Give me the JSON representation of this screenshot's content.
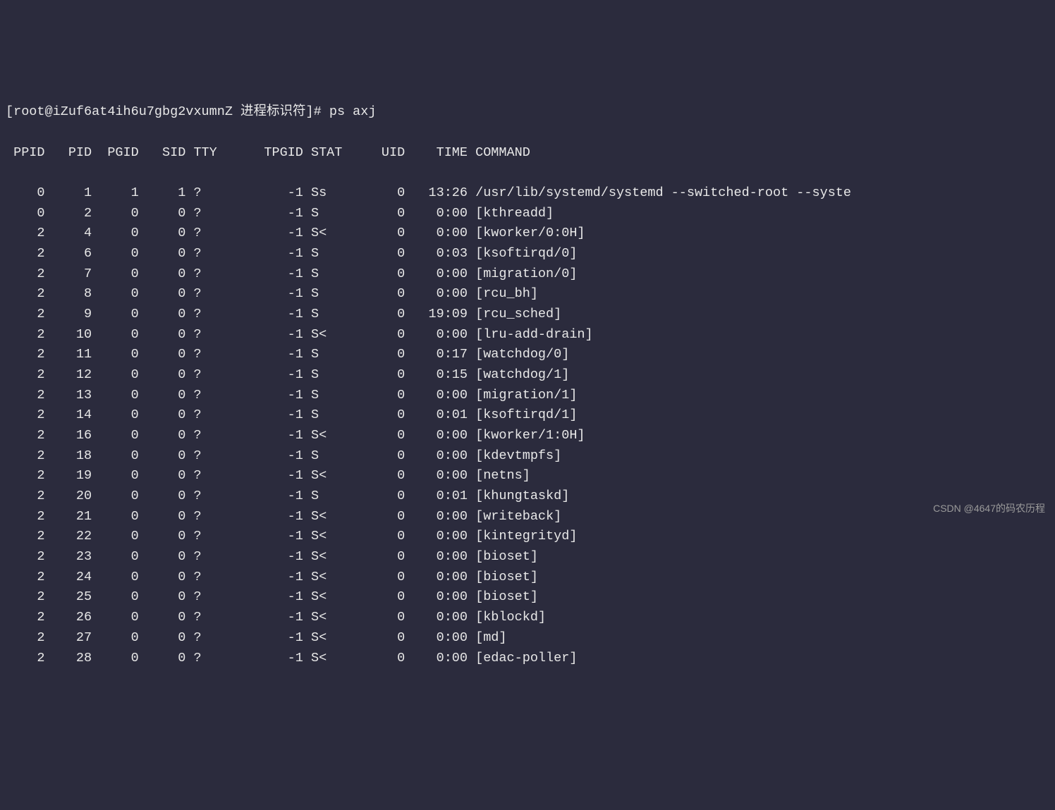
{
  "prompt": {
    "user_host": "[root@iZuf6at4ih6u7gbg2vxumnZ 进程标识符]# ",
    "command": "ps axj"
  },
  "headers": [
    "PPID",
    "PID",
    "PGID",
    "SID",
    "TTY",
    "TPGID",
    "STAT",
    "UID",
    "TIME",
    "COMMAND"
  ],
  "rows": [
    {
      "ppid": "0",
      "pid": "1",
      "pgid": "1",
      "sid": "1",
      "tty": "?",
      "tpgid": "-1",
      "stat": "Ss",
      "uid": "0",
      "time": "13:26",
      "command": "/usr/lib/systemd/systemd --switched-root --syste"
    },
    {
      "ppid": "0",
      "pid": "2",
      "pgid": "0",
      "sid": "0",
      "tty": "?",
      "tpgid": "-1",
      "stat": "S",
      "uid": "0",
      "time": "0:00",
      "command": "[kthreadd]"
    },
    {
      "ppid": "2",
      "pid": "4",
      "pgid": "0",
      "sid": "0",
      "tty": "?",
      "tpgid": "-1",
      "stat": "S<",
      "uid": "0",
      "time": "0:00",
      "command": "[kworker/0:0H]"
    },
    {
      "ppid": "2",
      "pid": "6",
      "pgid": "0",
      "sid": "0",
      "tty": "?",
      "tpgid": "-1",
      "stat": "S",
      "uid": "0",
      "time": "0:03",
      "command": "[ksoftirqd/0]"
    },
    {
      "ppid": "2",
      "pid": "7",
      "pgid": "0",
      "sid": "0",
      "tty": "?",
      "tpgid": "-1",
      "stat": "S",
      "uid": "0",
      "time": "0:00",
      "command": "[migration/0]"
    },
    {
      "ppid": "2",
      "pid": "8",
      "pgid": "0",
      "sid": "0",
      "tty": "?",
      "tpgid": "-1",
      "stat": "S",
      "uid": "0",
      "time": "0:00",
      "command": "[rcu_bh]"
    },
    {
      "ppid": "2",
      "pid": "9",
      "pgid": "0",
      "sid": "0",
      "tty": "?",
      "tpgid": "-1",
      "stat": "S",
      "uid": "0",
      "time": "19:09",
      "command": "[rcu_sched]"
    },
    {
      "ppid": "2",
      "pid": "10",
      "pgid": "0",
      "sid": "0",
      "tty": "?",
      "tpgid": "-1",
      "stat": "S<",
      "uid": "0",
      "time": "0:00",
      "command": "[lru-add-drain]"
    },
    {
      "ppid": "2",
      "pid": "11",
      "pgid": "0",
      "sid": "0",
      "tty": "?",
      "tpgid": "-1",
      "stat": "S",
      "uid": "0",
      "time": "0:17",
      "command": "[watchdog/0]"
    },
    {
      "ppid": "2",
      "pid": "12",
      "pgid": "0",
      "sid": "0",
      "tty": "?",
      "tpgid": "-1",
      "stat": "S",
      "uid": "0",
      "time": "0:15",
      "command": "[watchdog/1]"
    },
    {
      "ppid": "2",
      "pid": "13",
      "pgid": "0",
      "sid": "0",
      "tty": "?",
      "tpgid": "-1",
      "stat": "S",
      "uid": "0",
      "time": "0:00",
      "command": "[migration/1]"
    },
    {
      "ppid": "2",
      "pid": "14",
      "pgid": "0",
      "sid": "0",
      "tty": "?",
      "tpgid": "-1",
      "stat": "S",
      "uid": "0",
      "time": "0:01",
      "command": "[ksoftirqd/1]"
    },
    {
      "ppid": "2",
      "pid": "16",
      "pgid": "0",
      "sid": "0",
      "tty": "?",
      "tpgid": "-1",
      "stat": "S<",
      "uid": "0",
      "time": "0:00",
      "command": "[kworker/1:0H]"
    },
    {
      "ppid": "2",
      "pid": "18",
      "pgid": "0",
      "sid": "0",
      "tty": "?",
      "tpgid": "-1",
      "stat": "S",
      "uid": "0",
      "time": "0:00",
      "command": "[kdevtmpfs]"
    },
    {
      "ppid": "2",
      "pid": "19",
      "pgid": "0",
      "sid": "0",
      "tty": "?",
      "tpgid": "-1",
      "stat": "S<",
      "uid": "0",
      "time": "0:00",
      "command": "[netns]"
    },
    {
      "ppid": "2",
      "pid": "20",
      "pgid": "0",
      "sid": "0",
      "tty": "?",
      "tpgid": "-1",
      "stat": "S",
      "uid": "0",
      "time": "0:01",
      "command": "[khungtaskd]"
    },
    {
      "ppid": "2",
      "pid": "21",
      "pgid": "0",
      "sid": "0",
      "tty": "?",
      "tpgid": "-1",
      "stat": "S<",
      "uid": "0",
      "time": "0:00",
      "command": "[writeback]"
    },
    {
      "ppid": "2",
      "pid": "22",
      "pgid": "0",
      "sid": "0",
      "tty": "?",
      "tpgid": "-1",
      "stat": "S<",
      "uid": "0",
      "time": "0:00",
      "command": "[kintegrityd]"
    },
    {
      "ppid": "2",
      "pid": "23",
      "pgid": "0",
      "sid": "0",
      "tty": "?",
      "tpgid": "-1",
      "stat": "S<",
      "uid": "0",
      "time": "0:00",
      "command": "[bioset]"
    },
    {
      "ppid": "2",
      "pid": "24",
      "pgid": "0",
      "sid": "0",
      "tty": "?",
      "tpgid": "-1",
      "stat": "S<",
      "uid": "0",
      "time": "0:00",
      "command": "[bioset]"
    },
    {
      "ppid": "2",
      "pid": "25",
      "pgid": "0",
      "sid": "0",
      "tty": "?",
      "tpgid": "-1",
      "stat": "S<",
      "uid": "0",
      "time": "0:00",
      "command": "[bioset]"
    },
    {
      "ppid": "2",
      "pid": "26",
      "pgid": "0",
      "sid": "0",
      "tty": "?",
      "tpgid": "-1",
      "stat": "S<",
      "uid": "0",
      "time": "0:00",
      "command": "[kblockd]"
    },
    {
      "ppid": "2",
      "pid": "27",
      "pgid": "0",
      "sid": "0",
      "tty": "?",
      "tpgid": "-1",
      "stat": "S<",
      "uid": "0",
      "time": "0:00",
      "command": "[md]"
    },
    {
      "ppid": "2",
      "pid": "28",
      "pgid": "0",
      "sid": "0",
      "tty": "?",
      "tpgid": "-1",
      "stat": "S<",
      "uid": "0",
      "time": "0:00",
      "command": "[edac-poller]"
    }
  ],
  "watermark": "CSDN @4647的码农历程"
}
